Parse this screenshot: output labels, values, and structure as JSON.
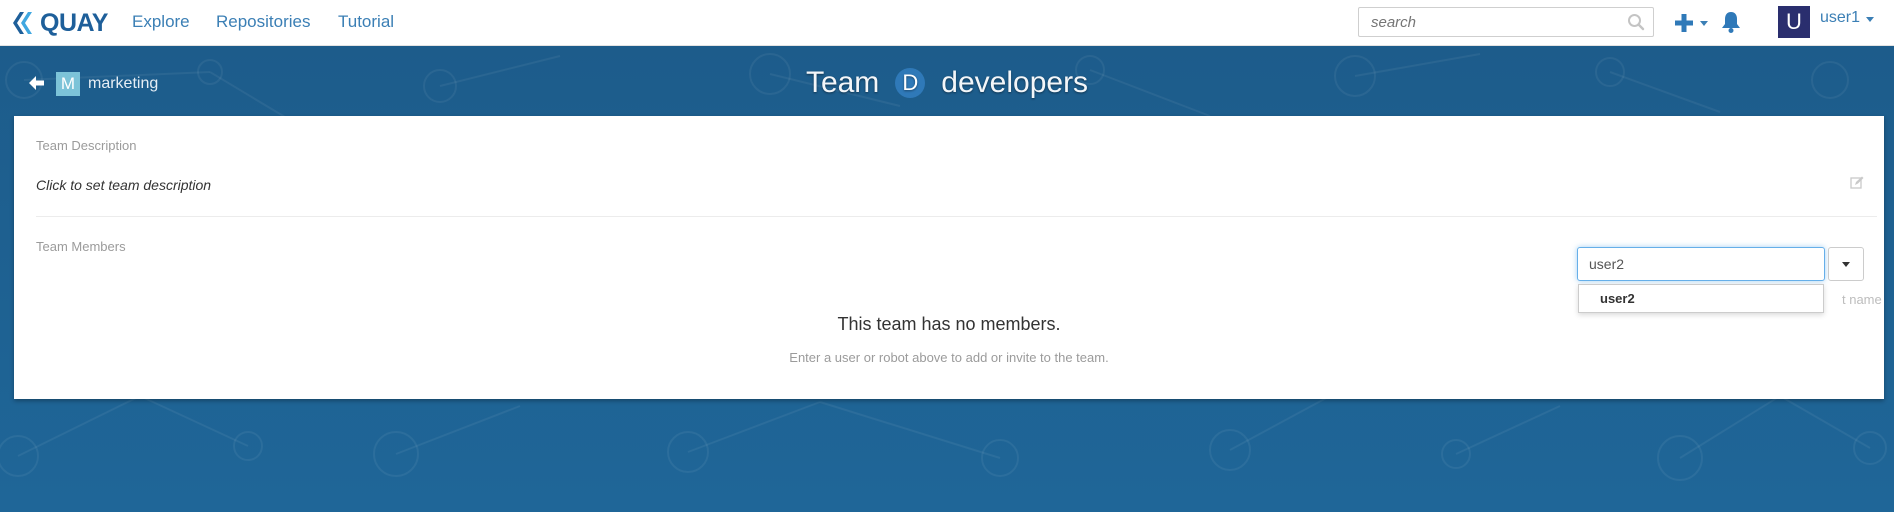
{
  "navbar": {
    "brand": "QUAY",
    "links": [
      "Explore",
      "Repositories",
      "Tutorial"
    ],
    "search_placeholder": "search",
    "user_initial": "U",
    "username": "user1"
  },
  "header": {
    "org_initial": "M",
    "org_name": "marketing",
    "title_prefix": "Team",
    "team_initial": "D",
    "team_name": "developers"
  },
  "card": {
    "description_label": "Team Description",
    "description_placeholder": "Click to set team description",
    "members_label": "Team Members",
    "member_input_value": "user2",
    "hint_partial": "t name",
    "suggestions": [
      "user2"
    ],
    "empty_title": "This team has no members.",
    "empty_subtitle": "Enter a user or robot above to add or invite to the team."
  },
  "colors": {
    "brand": "#1e5f9a",
    "link": "#3b7fb5",
    "band": "#1f6594",
    "user_avatar": "#2a2e6e",
    "org_avatar": "#7cc3d8",
    "team_avatar": "#2f79b8"
  }
}
